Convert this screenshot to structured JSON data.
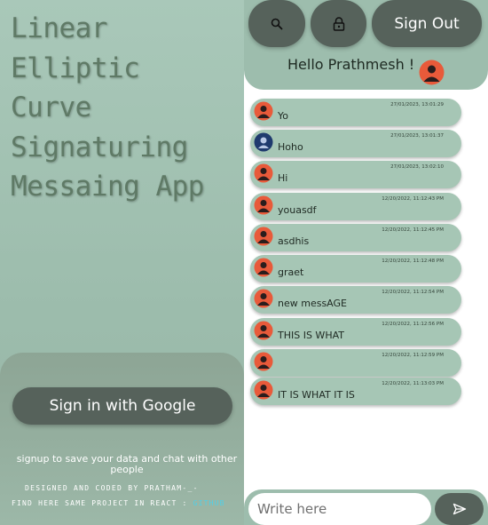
{
  "app": {
    "title_lines": [
      "Linear",
      "Elliptic",
      "Curve",
      "Signaturing",
      "Messaing App"
    ],
    "sign_in_label": "Sign in with Google",
    "signup_note": "signup to save your data and chat with other people",
    "credits_line1": "DESIGNED AND CODED BY PRATHAM-_-",
    "credits_line2": "FIND HERE SAME PROJECT IN REACT : ",
    "github_link": "GITHUB"
  },
  "header": {
    "search_icon": "search-icon",
    "lock_icon": "lock-icon",
    "sign_out_label": "Sign Out",
    "greeting": "Hello Prathmesh !"
  },
  "messages": [
    {
      "text": "Yo",
      "time": "27/01/2023, 13:01:29",
      "avatar": "red-avatar"
    },
    {
      "text": "Hoho",
      "time": "27/01/2023, 13:01:37",
      "avatar": "blue-avatar"
    },
    {
      "text": "Hi",
      "time": "27/01/2023, 13:02:10",
      "avatar": "red-avatar"
    },
    {
      "text": "youasdf",
      "time": "12/20/2022, 11:12:43 PM",
      "avatar": "red-avatar"
    },
    {
      "text": "asdhis",
      "time": "12/20/2022, 11:12:45 PM",
      "avatar": "red-avatar"
    },
    {
      "text": "graet",
      "time": "12/20/2022, 11:12:48 PM",
      "avatar": "red-avatar"
    },
    {
      "text": "new messAGE",
      "time": "12/20/2022, 11:12:54 PM",
      "avatar": "red-avatar"
    },
    {
      "text": "THIS IS WHAT",
      "time": "12/20/2022, 11:12:56 PM",
      "avatar": "red-avatar"
    },
    {
      "text": "",
      "time": "12/20/2022, 11:12:59 PM",
      "avatar": "red-avatar"
    },
    {
      "text": "IT IS WHAT IT IS",
      "time": "12/20/2022, 11:13:03 PM",
      "avatar": "red-avatar"
    }
  ],
  "composer": {
    "placeholder": "Write here",
    "send_icon": "send-icon"
  },
  "colors": {
    "panel": "#9dbdad",
    "button": "#56625b",
    "title_text": "#5f7a66",
    "link": "#4fd0e8"
  }
}
